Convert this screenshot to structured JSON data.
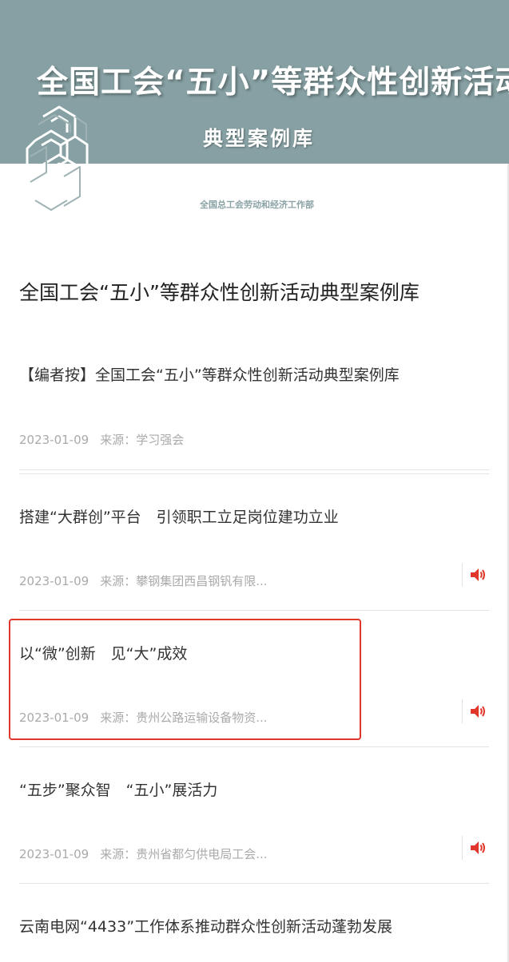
{
  "banner": {
    "title": "全国工会“五小”等群众性创新活动",
    "subtitle": "典型案例库",
    "dept": "全国总工会劳动和经济工作部",
    "band_color": "#86a0a3"
  },
  "page": {
    "title": "全国工会“五小”等群众性创新活动典型案例库"
  },
  "articles": [
    {
      "title": "【编者按】全国工会“五小”等群众性创新活动典型案例库",
      "date": "2023-01-09",
      "source": "来源：学习强会",
      "audio": false
    },
    {
      "title": "搭建“大群创”平台　引领职工立足岗位建功立业",
      "date": "2023-01-09",
      "source": "来源：攀钢集团西昌钢钒有限...",
      "audio": true
    },
    {
      "title": "以“微”创新　见“大”成效",
      "date": "2023-01-09",
      "source": "来源：贵州公路运输设备物资...",
      "audio": true,
      "highlighted": true
    },
    {
      "title": "“五步”聚众智　“五小”展活力",
      "date": "2023-01-09",
      "source": "来源：贵州省都匀供电局工会...",
      "audio": true
    },
    {
      "title": "云南电网“4433”工作体系推动群众性创新活动蓬勃发展"
    }
  ],
  "icons": {
    "audio": "speaker-icon",
    "logo": "maze-logo-icon"
  },
  "colors": {
    "accent_red": "#e0362c",
    "meta_gray": "#aaaaaa"
  }
}
